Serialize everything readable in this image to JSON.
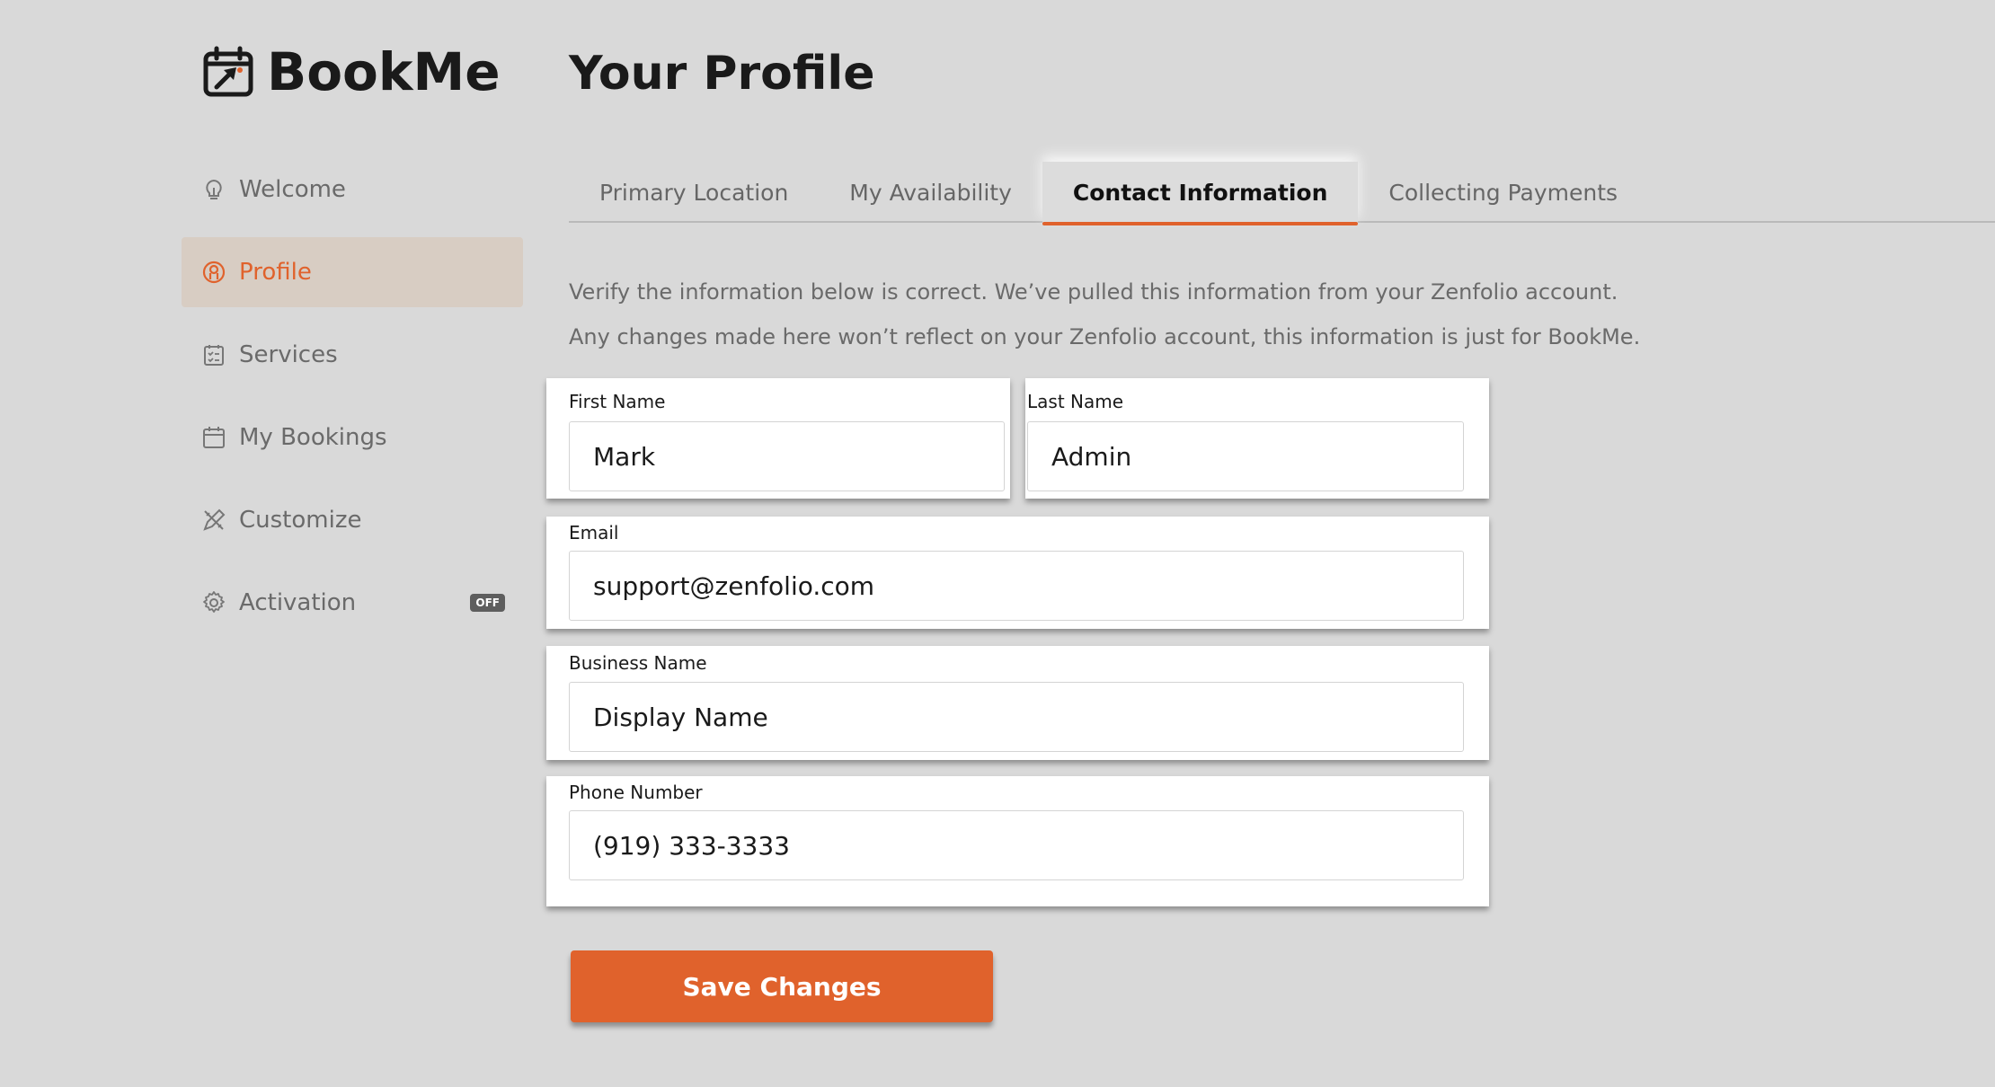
{
  "app": {
    "logo_text": "BookMe",
    "logo_icon": "calendar-arrow-icon",
    "accent_color": "#e0622c"
  },
  "sidebar": {
    "items": [
      {
        "label": "Welcome",
        "icon": "lightbulb-icon",
        "active": false
      },
      {
        "label": "Profile",
        "icon": "user-circle-icon",
        "active": true
      },
      {
        "label": "Services",
        "icon": "checklist-icon",
        "active": false
      },
      {
        "label": "My Bookings",
        "icon": "calendar-icon",
        "active": false
      },
      {
        "label": "Customize",
        "icon": "pencil-ruler-icon",
        "active": false
      },
      {
        "label": "Activation",
        "icon": "gear-icon",
        "active": false,
        "badge": "OFF"
      }
    ]
  },
  "page": {
    "title": "Your Profile"
  },
  "tabs": [
    {
      "label": "Primary Location",
      "active": false
    },
    {
      "label": "My Availability",
      "active": false
    },
    {
      "label": "Contact Information",
      "active": true
    },
    {
      "label": "Collecting Payments",
      "active": false
    }
  ],
  "intro": {
    "text": "Verify the information below is correct. We’ve pulled this information from your Zenfolio account. Any changes made here won’t reflect on your Zenfolio account, this information is just for BookMe."
  },
  "form": {
    "first_name": {
      "label": "First Name",
      "value": "Mark"
    },
    "last_name": {
      "label": "Last Name",
      "value": "Admin"
    },
    "email": {
      "label": "Email",
      "value": "support@zenfolio.com"
    },
    "business_name": {
      "label": "Business Name",
      "value": "Display Name"
    },
    "phone_number": {
      "label": "Phone Number",
      "value": "(919) 333-3333"
    }
  },
  "actions": {
    "save_label": "Save Changes"
  }
}
